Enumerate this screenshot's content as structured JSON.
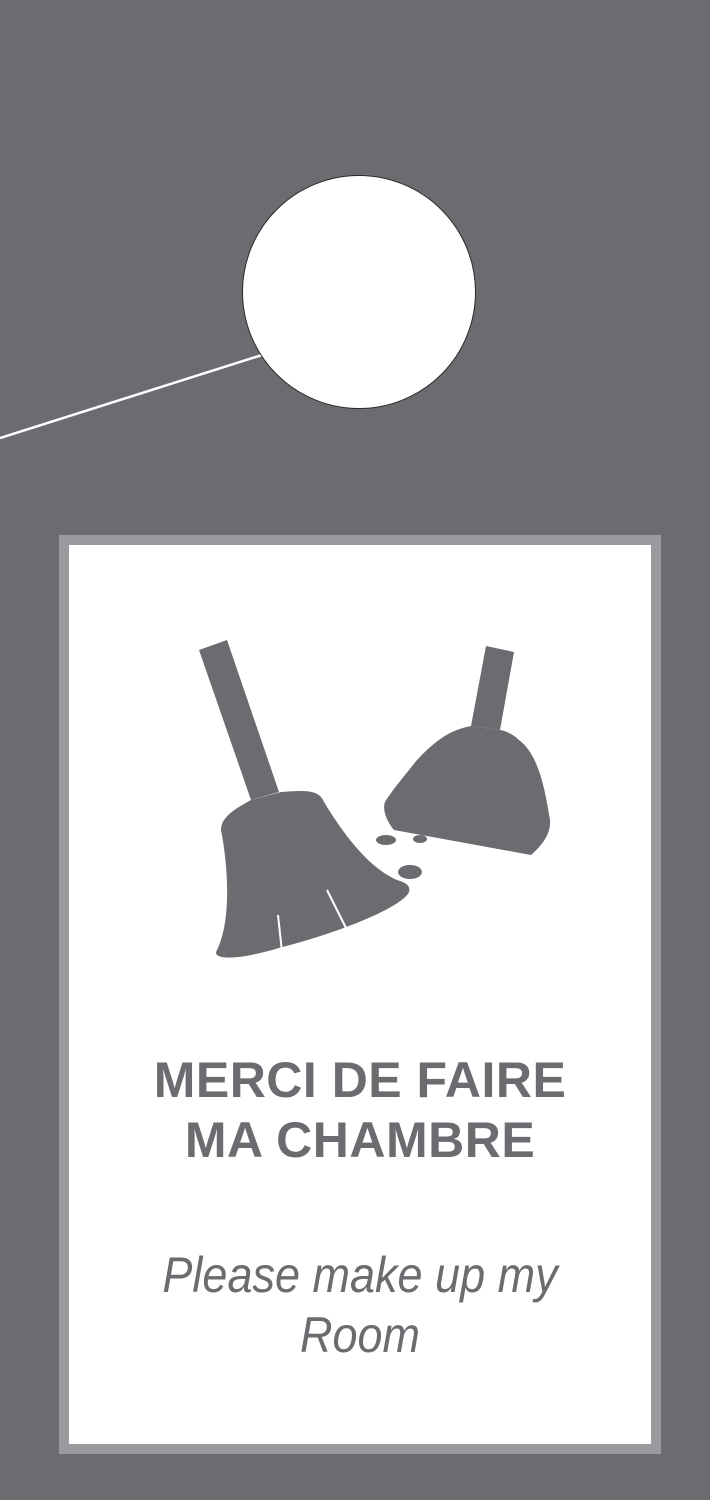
{
  "hanger": {
    "colors": {
      "body": "#6b6c70",
      "frame": "#9a9b9e",
      "panel": "#ffffff",
      "text": "#6b6c70"
    },
    "icon": "broom-and-dustpan-icon",
    "title_line1": "MERCI DE FAIRE",
    "title_line2": "MA CHAMBRE",
    "subtitle": "Please make up my Room"
  }
}
